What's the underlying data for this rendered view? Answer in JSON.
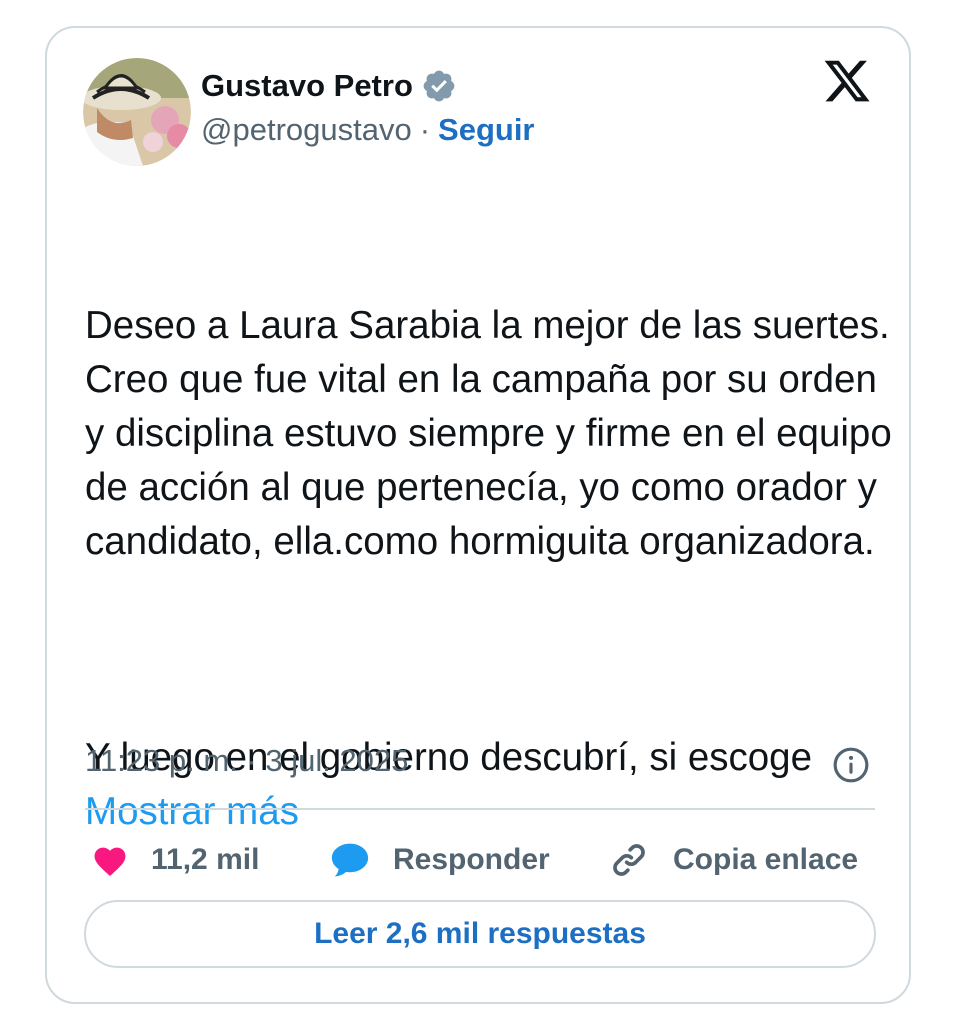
{
  "author": {
    "name": "Gustavo Petro",
    "handle": "@petrogustavo",
    "separator": "·",
    "follow_label": "Seguir",
    "verified": true,
    "avatar_icon": "profile-photo-with-sombrero-vueltiao"
  },
  "platform_icon": "x-logo-icon",
  "tweet": {
    "paragraph1": "Deseo a Laura Sarabia la mejor de las suertes. Creo que fue vital en la campaña por su orden y disciplina estuvo siempre y firme en el equipo de acción al que pertenecía, yo como orador y candidato, ella.como hormiguita organizadora.",
    "paragraph2": "Y luego en el gobierno descubrí, si escoge",
    "show_more_label": "Mostrar más"
  },
  "timestamp": "11:23 p. m. · 3 jul. 2025",
  "actions": {
    "likes_count": "11,2 mil",
    "reply_label": "Responder",
    "copy_link_label": "Copia enlace"
  },
  "read_replies_label": "Leer 2,6 mil respuestas",
  "colors": {
    "like": "#f91880",
    "reply": "#1d9bf0",
    "link": "#1d9bf0",
    "follow": "#1d6fc4",
    "text": "#0f1419",
    "secondary": "#536471",
    "border": "#cfd9de"
  }
}
